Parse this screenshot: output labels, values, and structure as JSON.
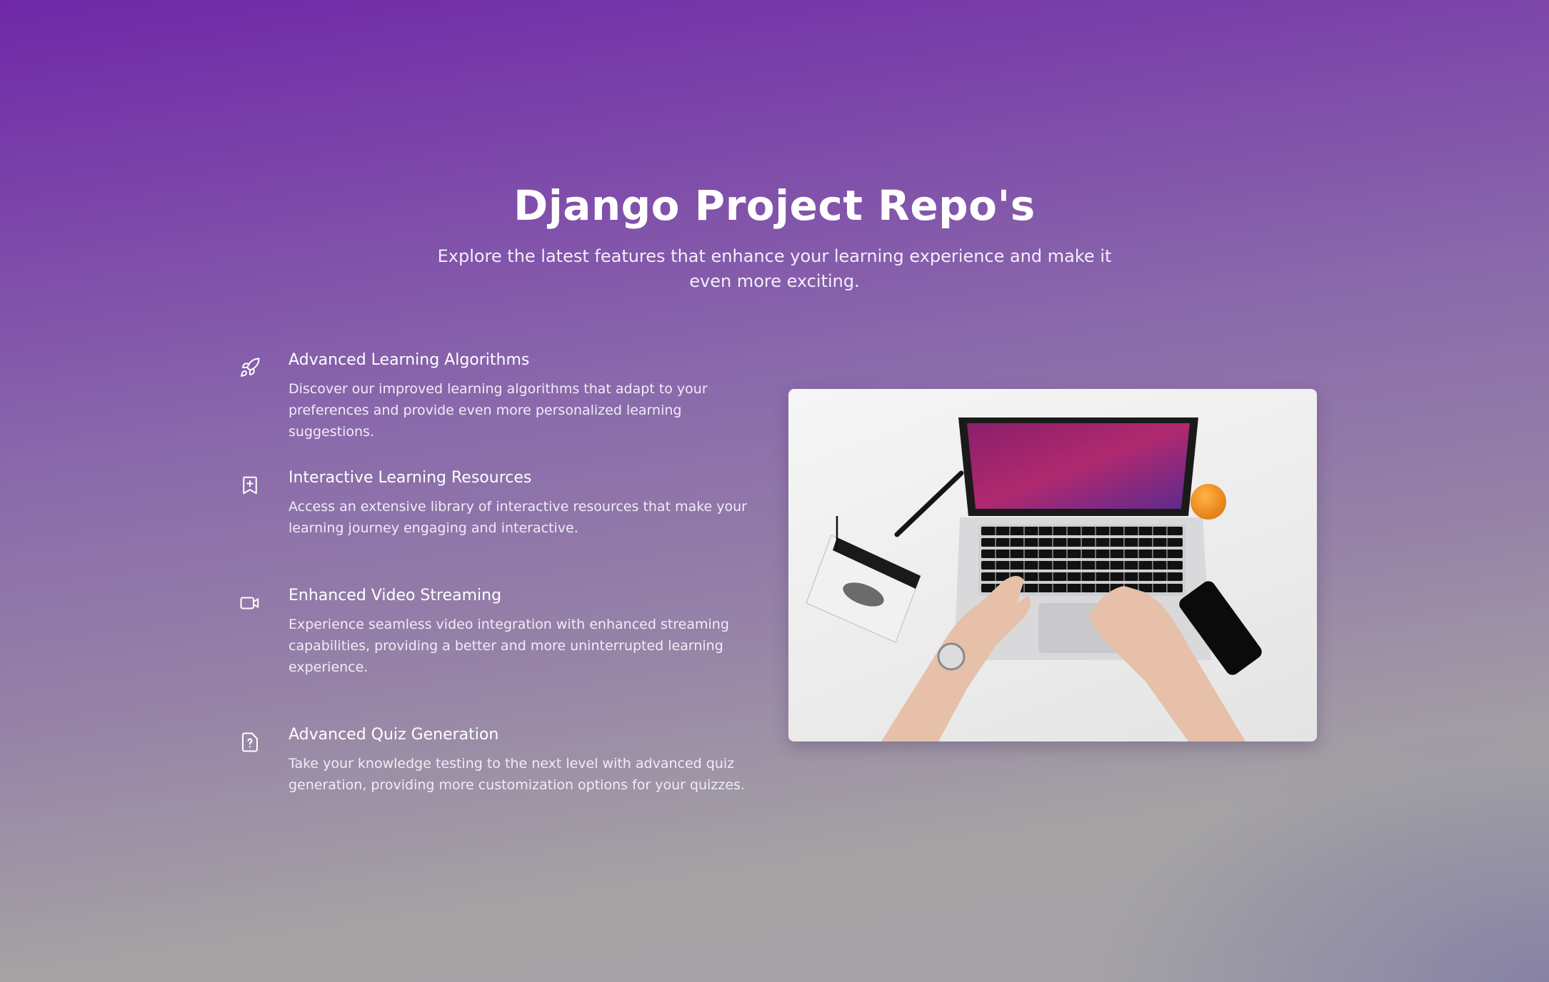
{
  "hero": {
    "title": "Django Project Repo's",
    "subtitle": "Explore the latest features that enhance your learning experience and make it even more exciting."
  },
  "features": [
    {
      "icon": "rocket-icon",
      "title": "Advanced Learning Algorithms",
      "description": "Discover our improved learning algorithms that adapt to your preferences and provide even more personalized learning suggestions."
    },
    {
      "icon": "bookmark-plus-icon",
      "title": "Interactive Learning Resources",
      "description": "Access an extensive library of interactive resources that make your learning journey engaging and interactive."
    },
    {
      "icon": "video-camera-icon",
      "title": "Enhanced Video Streaming",
      "description": "Experience seamless video integration with enhanced streaming capabilities, providing a better and more uninterrupted learning experience."
    },
    {
      "icon": "file-question-icon",
      "title": "Advanced Quiz Generation",
      "description": "Take your knowledge testing to the next level with advanced quiz generation, providing more customization options for your quizzes."
    }
  ],
  "image": {
    "subject": "laptop-workspace-photo"
  },
  "colors": {
    "gradient_top": "#6f28a8",
    "gradient_bottom": "#a5a3a4",
    "text": "#ffffff"
  }
}
